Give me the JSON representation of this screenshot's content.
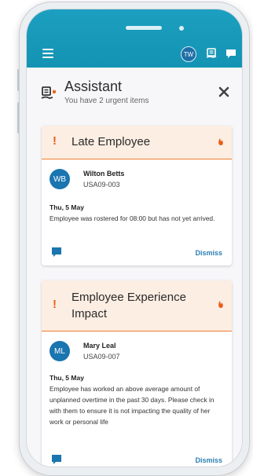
{
  "topbar": {
    "user_initials": "TW",
    "accent": "#1899b9"
  },
  "assistant": {
    "title": "Assistant",
    "subtitle": "You have 2 urgent items",
    "icons": {
      "header_icon": "assistant-icon",
      "close_icon": "close-icon"
    }
  },
  "cards": [
    {
      "title": "Late Employee",
      "person": {
        "initials": "WB",
        "name": "Wilton Betts",
        "id": "USA09-003"
      },
      "date": "Thu, 5 May",
      "message": "Employee was rostered for 08:00 but has not yet arrived.",
      "action": "Dismiss"
    },
    {
      "title": "Employee Experience Impact",
      "person": {
        "initials": "ML",
        "name": "Mary Leal",
        "id": "USA09-007"
      },
      "date": "Thu, 5 May",
      "message": "Employee has worked an above average amount of unplanned overtime in the past 30 days. Please check in with them to ensure it is not impacting the quality of her work or personal life",
      "action": "Dismiss"
    }
  ],
  "colors": {
    "urgent": "#e95d18",
    "card_header_bg": "#fceee3",
    "link": "#2d7fb3"
  }
}
